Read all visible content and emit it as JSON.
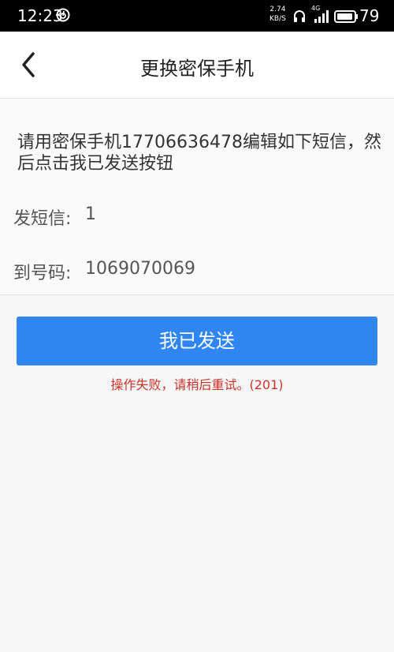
{
  "status_bar": {
    "time": "12:23",
    "speed_value": "2.74",
    "speed_unit": "KB/S",
    "network_label": "4G",
    "battery_level": "79"
  },
  "nav": {
    "title": "更换密保手机"
  },
  "instruction": "请用密保手机17706636478编辑如下短信，然后点击我已发送按钮",
  "sms_row": {
    "label": "发短信:",
    "value": "1"
  },
  "number_row": {
    "label": "到号码:",
    "value": "1069070069"
  },
  "sent_button_label": "我已发送",
  "error_text": "操作失败，请稍后重试。(201)",
  "colors": {
    "accent": "#2f86f0",
    "error": "#c9332a",
    "status_bar_bg": "#000000"
  }
}
